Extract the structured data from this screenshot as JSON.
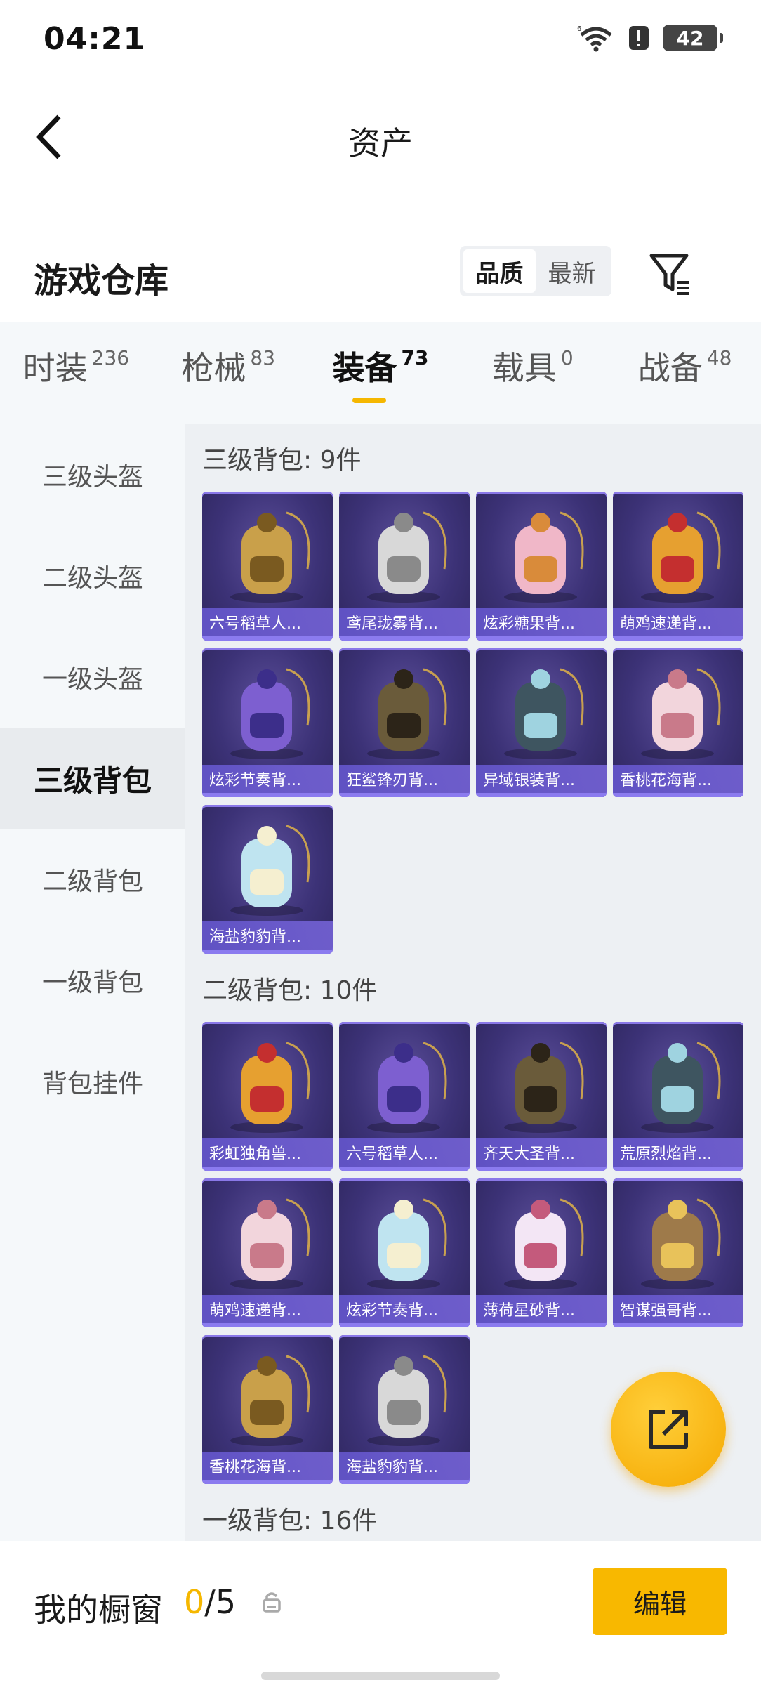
{
  "status": {
    "time": "04:21",
    "battery": "42"
  },
  "header": {
    "title": "资产"
  },
  "warehouse": {
    "title": "游戏仓库",
    "sort_options": [
      "品质",
      "最新"
    ],
    "active_sort": "品质"
  },
  "tabs": [
    {
      "label": "时装",
      "count": "236"
    },
    {
      "label": "枪械",
      "count": "83"
    },
    {
      "label": "装备",
      "count": "73",
      "active": true
    },
    {
      "label": "载具",
      "count": "0"
    },
    {
      "label": "战备",
      "count": "48"
    }
  ],
  "sidebar": {
    "items": [
      "三级头盔",
      "二级头盔",
      "一级头盔",
      "三级背包",
      "二级背包",
      "一级背包",
      "背包挂件"
    ],
    "active": "三级背包"
  },
  "sections": [
    {
      "title": "三级背包: 9件",
      "items": [
        "六号稻草人...",
        "鸢尾珑雾背...",
        "炫彩糖果背...",
        "萌鸡速递背...",
        "炫彩节奏背...",
        "狂鲨锋刃背...",
        "异域银装背...",
        "香桃花海背...",
        "海盐豹豹背..."
      ]
    },
    {
      "title": "二级背包: 10件",
      "items": [
        "彩虹独角兽...",
        "六号稻草人...",
        "齐天大圣背...",
        "荒原烈焰背...",
        "萌鸡速递背...",
        "炫彩节奏背...",
        "薄荷星砂背...",
        "智谋强哥背...",
        "香桃花海背...",
        "海盐豹豹背..."
      ]
    },
    {
      "title": "一级背包: 16件",
      "items": []
    }
  ],
  "showcase": {
    "label": "我的橱窗",
    "current": "0",
    "total": "/5"
  },
  "edit_button": "编辑",
  "colors": {
    "accent": "#f5b700",
    "card_bg": "#3c3277",
    "card_label": "#6254c8"
  },
  "icons": [
    "back-arrow-icon",
    "filter-icon",
    "share-icon",
    "lock-icon",
    "wifi-icon",
    "alert-icon"
  ]
}
